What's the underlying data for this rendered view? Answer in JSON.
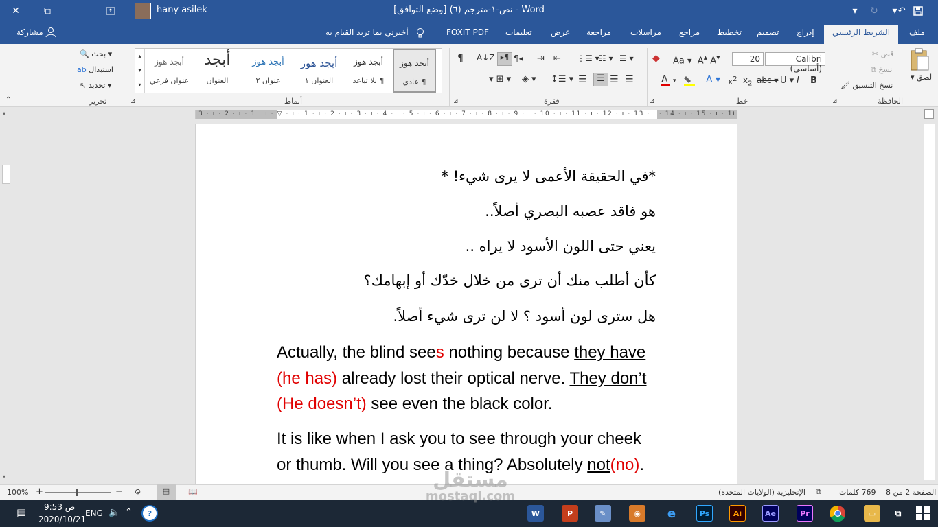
{
  "titlebar": {
    "doc_title": "نص-١-مترجم (٦) [وضع التوافق]  -  Word",
    "user": "hany asilek",
    "close": "✕",
    "restore": "⧉"
  },
  "ribbon_tabs": [
    "ملف",
    "الشريط الرئيسي",
    "إدراج",
    "تصميم",
    "تخطيط",
    "مراجع",
    "مراسلات",
    "مراجعة",
    "عرض",
    "تعليمات",
    "FOXIT PDF"
  ],
  "tell_me": "أخبرني بما تريد القيام به",
  "share": "مشاركة",
  "clipboard": {
    "label": "الحافظة",
    "paste": "لصق",
    "cut": "قص",
    "copy": "نسخ",
    "format_painter": "نسخ التنسيق"
  },
  "font": {
    "label": "خط",
    "name": "Calibri (أساسي)",
    "size": "20"
  },
  "paragraph": {
    "label": "فقرة"
  },
  "styles": {
    "label": "أنماط",
    "items": [
      {
        "preview": "أبجد هوز",
        "name": "¶ عادي"
      },
      {
        "preview": "أبجد هوز",
        "name": "¶ بلا تباعد"
      },
      {
        "preview": "أبجد هوز",
        "name": "العنوان ١"
      },
      {
        "preview": "أبجد هوز",
        "name": "عنوان ٢"
      },
      {
        "preview": "أبجد",
        "name": "العنوان"
      },
      {
        "preview": "أبجد هوز",
        "name": "عنوان فرعي"
      }
    ]
  },
  "editing": {
    "label": "تحرير",
    "find": "بحث",
    "replace": "استبدال",
    "select": "تحديد"
  },
  "document": {
    "arabic_lines": [
      "*في الحقيقة الأعمى لا يرى شيء! *",
      "هو فاقد عصبه البصري أصلاً..",
      "يعني حتى اللون الأسود لا يراه ..",
      "كأن أطلب منك أن ترى من خلال خدّك أو إبهامك؟",
      "هل سترى لون أسود ؟ لا لن ترى شيء أصلاً."
    ],
    "en_p1": {
      "t1": "Actually, the blind see",
      "t1_red": "s",
      "t2": " nothing because ",
      "t3_ul": "they have",
      "t4_red": "(he has)",
      "t5": " already lost their optical nerve. ",
      "t6_ul": "They don’t",
      "t7_red": "(He doesn’t)",
      "t8": " see even the black color."
    },
    "en_p2": {
      "t1": "It is like when I ask you to see through your cheek or thumb. Will you see a thing? Absolutely ",
      "t2_ul": "not",
      "t3_red": "(no)",
      "t4": "."
    }
  },
  "statusbar": {
    "page": "الصفحة 2 من 8",
    "words": "769 كلمات",
    "language": "الإنجليزية (الولايات المتحدة)",
    "zoom": "100%"
  },
  "taskbar": {
    "time": "9:53 ص",
    "date": "2020/10/21",
    "lang": "ENG"
  },
  "watermark": {
    "logo": "مستقل",
    "url": "mostaql.com"
  },
  "colors": {
    "word_blue": "#2b579a",
    "taskbar": "#1c2836",
    "red_text": "#e00000"
  }
}
